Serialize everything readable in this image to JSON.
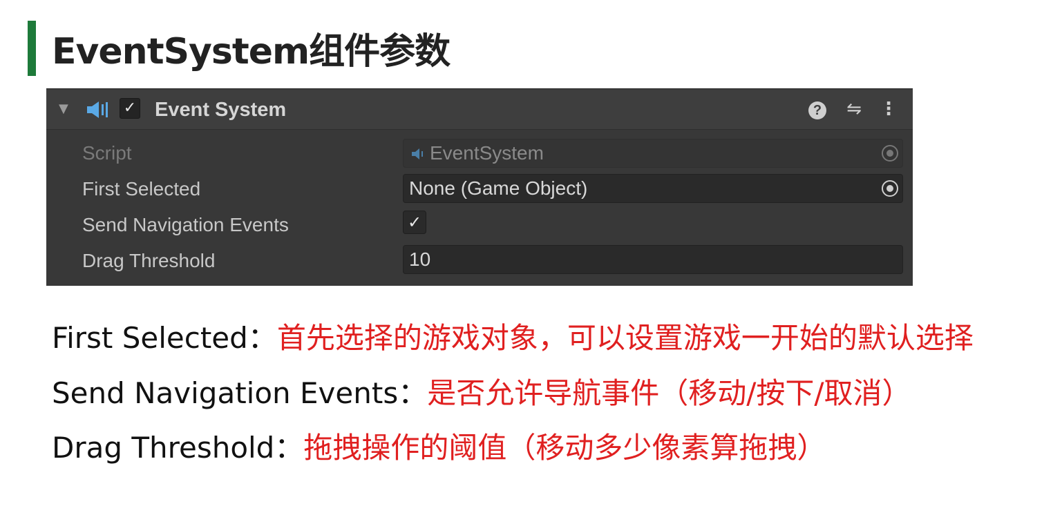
{
  "slide": {
    "title": "EventSystem组件参数",
    "accent_color": "#1e7a3a"
  },
  "inspector": {
    "header": {
      "foldout_icon": "triangle-down-icon",
      "component_icon": "event-system-icon",
      "enabled_check": "✓",
      "component_name": "Event System",
      "help_icon_glyph": "?",
      "preset_icon_glyph": "⇋",
      "menu_icon_glyph": "⋮"
    },
    "properties": {
      "script": {
        "label": "Script",
        "value": "EventSystem"
      },
      "first_selected": {
        "label": "First Selected",
        "value": "None (Game Object)"
      },
      "send_navigation_events": {
        "label": "Send Navigation Events",
        "check": "✓"
      },
      "drag_threshold": {
        "label": "Drag Threshold",
        "value": "10"
      }
    }
  },
  "descriptions": [
    {
      "term": "First Selected：",
      "text": "首先选择的游戏对象，可以设置游戏一开始的默认选择"
    },
    {
      "term": "Send Navigation Events：",
      "text": "是否允许导航事件（移动/按下/取消）"
    },
    {
      "term": "Drag Threshold：",
      "text": "拖拽操作的阈值（移动多少像素算拖拽）"
    }
  ],
  "colors": {
    "panel_bg": "#383838",
    "field_bg": "#2a2a2a",
    "description_highlight": "#e02020"
  }
}
